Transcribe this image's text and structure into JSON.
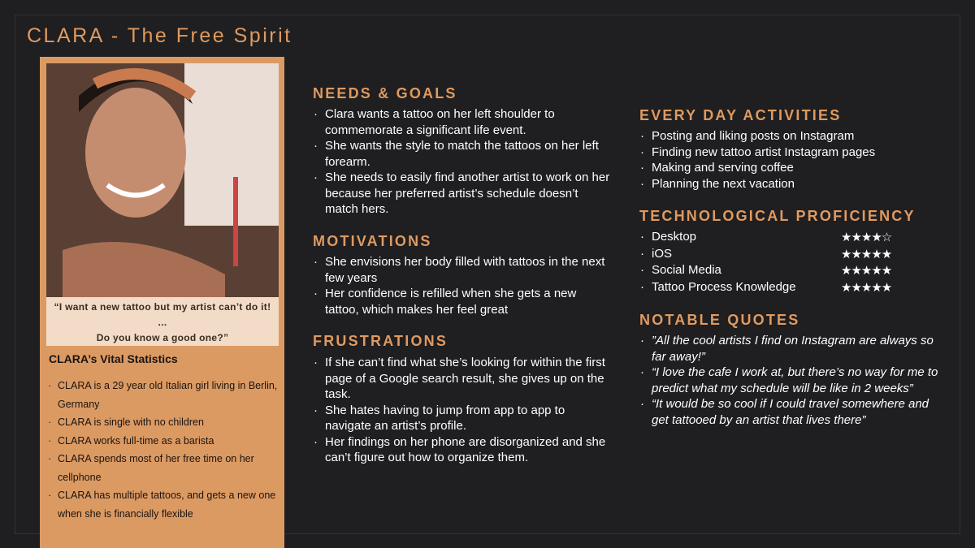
{
  "title": "CLARA - The Free Spirit",
  "photo": {
    "quote_line1": "“I want a new tattoo but my artist can’t do it!",
    "quote_line2": "...",
    "quote_line3": "Do you know a good one?”"
  },
  "vital": {
    "title": "CLARA’s Vital Statistics",
    "items": [
      "CLARA is a 29 year old Italian girl living in Berlin, Germany",
      "CLARA is single with no children",
      "CLARA works full-time as a barista",
      "CLARA spends most of her free time on her cellphone",
      "CLARA has multiple tattoos, and gets a new one when she is financially flexible"
    ]
  },
  "needs": {
    "title": "NEEDS & GOALS",
    "items": [
      "Clara wants a tattoo on her left shoulder to commemorate a significant life event.",
      "She wants the style to match the tattoos on her left forearm.",
      "She needs to easily find another artist to work on her because her preferred artist’s schedule doesn’t match hers."
    ]
  },
  "motivations": {
    "title": "MOTIVATIONS",
    "items": [
      "She envisions her body filled with tattoos in the next few years",
      "Her confidence is refilled when she gets a new tattoo, which makes her feel great"
    ]
  },
  "frustrations": {
    "title": "FRUSTRATIONS",
    "items": [
      "If she can’t find what she’s looking for within the first page of a Google search result, she gives up on the task.",
      "She hates having to jump from app to app to navigate an artist’s profile.",
      "Her findings on her phone are disorganized and she can’t figure out how to organize them."
    ]
  },
  "activities": {
    "title": "EVERY DAY ACTIVITIES",
    "items": [
      "Posting and liking posts on Instagram",
      "Finding new tattoo artist Instagram pages",
      "Making and serving coffee",
      "Planning the next vacation"
    ]
  },
  "tech": {
    "title": "TECHNOLOGICAL PROFICIENCY",
    "items": [
      {
        "label": "Desktop",
        "rating": 4,
        "stars": "★★★★☆"
      },
      {
        "label": "iOS",
        "rating": 5,
        "stars": "★★★★★"
      },
      {
        "label": "Social Media",
        "rating": 5,
        "stars": "★★★★★"
      },
      {
        "label": "Tattoo Process Knowledge",
        "rating": 5,
        "stars": "★★★★★"
      }
    ]
  },
  "quotes": {
    "title": "NOTABLE QUOTES",
    "items": [
      "”All the cool artists I find on Instagram are always so far away!”",
      "“I love the cafe I work at, but there’s no way for me to predict what my schedule will be like in 2 weeks”",
      "“It would be so cool if I could travel somewhere and get tattooed by an artist that lives there”"
    ]
  },
  "colors": {
    "accent": "#df9a60",
    "panel": "#dc9a63",
    "background": "#1f1e20"
  }
}
